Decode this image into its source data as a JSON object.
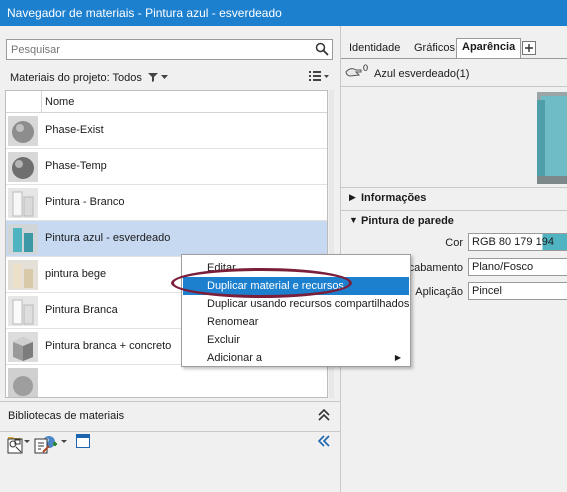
{
  "window": {
    "title": "Navegador de materiais - Pintura azul - esverdeado"
  },
  "search": {
    "placeholder": "Pesquisar",
    "icon": "search-icon"
  },
  "filter": {
    "label": "Materiais do projeto: Todos"
  },
  "list": {
    "header": "Nome",
    "items": [
      {
        "name": "Phase-Exist",
        "thumb": "gray-sphere",
        "selected": false
      },
      {
        "name": "Phase-Temp",
        "thumb": "gray-sphere",
        "selected": false
      },
      {
        "name": "Pintura - Branco",
        "thumb": "white-panels",
        "selected": false
      },
      {
        "name": "Pintura azul - esverdeado",
        "thumb": "teal-panels",
        "selected": true
      },
      {
        "name": "pintura bege",
        "thumb": "beige-panels",
        "selected": false
      },
      {
        "name": "Pintura Branca",
        "thumb": "white-panels",
        "selected": false
      },
      {
        "name": "Pintura branca + concreto",
        "thumb": "gray-cube",
        "selected": false
      }
    ]
  },
  "context_menu": {
    "items": [
      {
        "label": "Editar",
        "highlighted": false
      },
      {
        "label": "Duplicar material e recursos",
        "highlighted": true
      },
      {
        "label": "Duplicar usando recursos compartilhados",
        "highlighted": false
      },
      {
        "label": "Renomear",
        "highlighted": false
      },
      {
        "label": "Excluir",
        "highlighted": false
      },
      {
        "label": "Adicionar a",
        "highlighted": false,
        "submenu": true
      }
    ]
  },
  "libraries": {
    "label": "Bibliotecas de materiais"
  },
  "right": {
    "tabs": [
      "Identidade",
      "Gráficos",
      "Aparência"
    ],
    "active_tab": "Aparência",
    "asset": {
      "users": "0",
      "name": "Azul esverdeado(1)"
    },
    "sections": {
      "info": "Informações",
      "paint": "Pintura de parede"
    },
    "props": [
      {
        "label": "Cor",
        "value": "RGB 80 179 194"
      },
      {
        "label": "Acabamento",
        "value": "Plano/Fosco"
      },
      {
        "label": "Aplicação",
        "value": "Pincel"
      }
    ]
  },
  "colors": {
    "accent": "#1d80cf",
    "selection": "#c6d9f1",
    "swatch": "#50b3c2",
    "annotation": "#7a1e3a"
  }
}
